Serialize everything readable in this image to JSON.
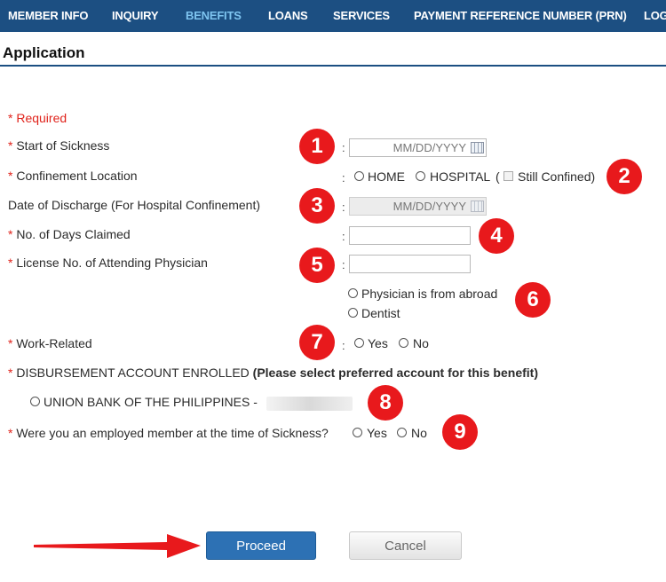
{
  "nav": {
    "items": [
      "MEMBER INFO",
      "INQUIRY",
      "BENEFITS",
      "LOANS",
      "SERVICES",
      "PAYMENT REFERENCE NUMBER (PRN)",
      "LOG"
    ],
    "active": "BENEFITS"
  },
  "page": {
    "title": "Application"
  },
  "form": {
    "required_note": "* Required",
    "asterisk": "*",
    "colon": ":",
    "start_of_sickness": {
      "label": "Start of Sickness",
      "placeholder": "MM/DD/YYYY"
    },
    "confinement": {
      "label": "Confinement Location",
      "options": [
        "HOME",
        "HOSPITAL"
      ],
      "paren_open": "(",
      "still_confined": "Still Confined)"
    },
    "discharge": {
      "label": "Date of Discharge (For Hospital Confinement)",
      "placeholder": "MM/DD/YYYY"
    },
    "days_claimed": {
      "label": "No. of Days Claimed",
      "value": ""
    },
    "license": {
      "label": "License No. of Attending Physician",
      "value": "",
      "options": [
        "Physician is from abroad",
        "Dentist"
      ]
    },
    "work_related": {
      "label": "Work-Related",
      "options": [
        "Yes",
        "No"
      ]
    },
    "disbursement": {
      "label": "DISBURSEMENT ACCOUNT ENROLLED",
      "note": "(Please select preferred account for this benefit)",
      "account": "UNION BANK OF THE PHILIPPINES -"
    },
    "employed": {
      "label": "Were you an employed member at the time of Sickness?",
      "options": [
        "Yes",
        "No"
      ]
    }
  },
  "annotations": [
    "1",
    "2",
    "3",
    "4",
    "5",
    "6",
    "7",
    "8",
    "9"
  ],
  "buttons": {
    "proceed": "Proceed",
    "cancel": "Cancel"
  },
  "colors": {
    "nav_bg": "#1c4f82",
    "nav_active": "#7ec4f0",
    "required": "#e0231b",
    "badge": "#e8191c",
    "proceed_bg": "#2d71b4",
    "arrow": "#e8191c"
  }
}
